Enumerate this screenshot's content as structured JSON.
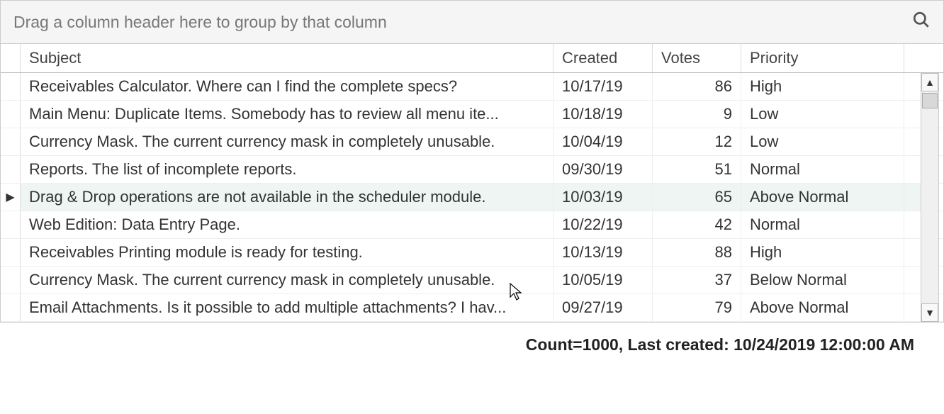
{
  "groupPanel": {
    "hint": "Drag a column header here to group by that column"
  },
  "columns": {
    "subject": "Subject",
    "created": "Created",
    "votes": "Votes",
    "priority": "Priority"
  },
  "rows": [
    {
      "subject": "Receivables Calculator. Where can I find the complete specs?",
      "created": "10/17/19",
      "votes": "86",
      "priority": "High",
      "focused": false
    },
    {
      "subject": "Main Menu: Duplicate Items. Somebody has to review all menu ite...",
      "created": "10/18/19",
      "votes": "9",
      "priority": "Low",
      "focused": false
    },
    {
      "subject": "Currency Mask. The current currency mask in completely unusable.",
      "created": "10/04/19",
      "votes": "12",
      "priority": "Low",
      "focused": false
    },
    {
      "subject": "Reports. The list of incomplete reports.",
      "created": "09/30/19",
      "votes": "51",
      "priority": "Normal",
      "focused": false
    },
    {
      "subject": "Drag & Drop operations are not available in the scheduler module.",
      "created": "10/03/19",
      "votes": "65",
      "priority": "Above Normal",
      "focused": true
    },
    {
      "subject": "Web Edition: Data Entry Page.",
      "created": "10/22/19",
      "votes": "42",
      "priority": "Normal",
      "focused": false
    },
    {
      "subject": "Receivables Printing module is ready for testing.",
      "created": "10/13/19",
      "votes": "88",
      "priority": "High",
      "focused": false
    },
    {
      "subject": "Currency Mask. The current currency mask in completely unusable.",
      "created": "10/05/19",
      "votes": "37",
      "priority": "Below Normal",
      "focused": false
    },
    {
      "subject": "Email Attachments. Is it possible to add multiple attachments? I hav...",
      "created": "09/27/19",
      "votes": "79",
      "priority": "Above Normal",
      "focused": false
    }
  ],
  "summary": "Count=1000, Last created: 10/24/2019 12:00:00 AM",
  "icons": {
    "rowIndicator": "▶",
    "scrollUp": "▲",
    "scrollDown": "▼"
  }
}
